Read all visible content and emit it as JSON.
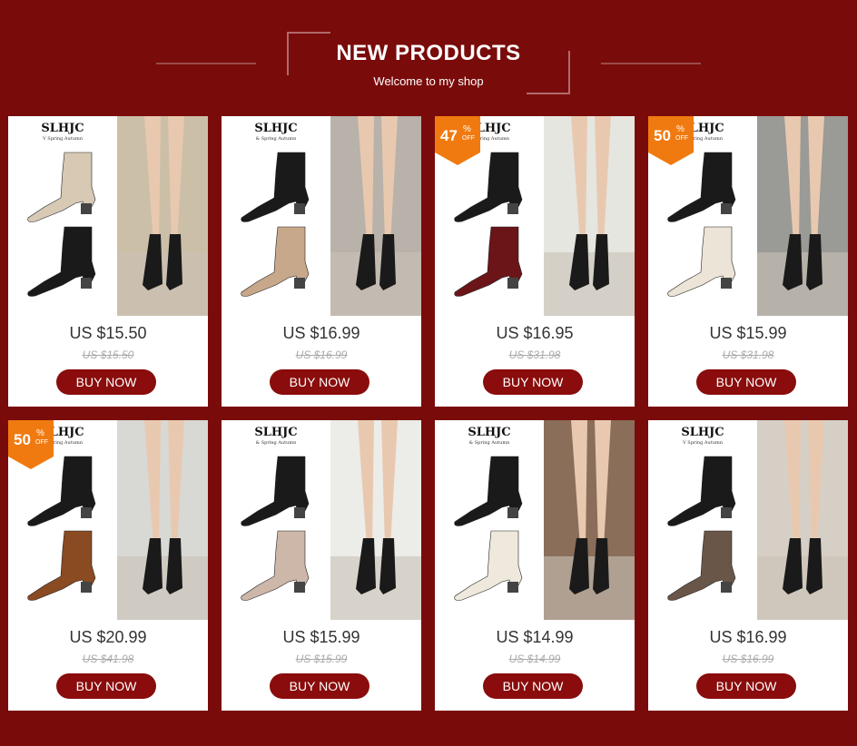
{
  "header": {
    "title": "NEW PRODUCTS",
    "subtitle": "Welcome to my shop"
  },
  "colors": {
    "background": "#7a0b0b",
    "button": "#8a0c0c",
    "badge": "#f07a10"
  },
  "products": [
    {
      "brand": "SLHJC",
      "brand_sub": "V Spring Autumn",
      "price": "US $15.50",
      "old_price": "US $15.50",
      "buy_label": "BUY NOW",
      "badge": null,
      "left_boot_color": "#d8c9b4",
      "left_boot2_color": "#1a1a1a",
      "right_bg": "#ccbfa8"
    },
    {
      "brand": "SLHJC",
      "brand_sub": "& Spring Autumn",
      "price": "US $16.99",
      "old_price": "US $16.99",
      "buy_label": "BUY NOW",
      "badge": null,
      "left_boot_color": "#1a1a1a",
      "left_boot2_color": "#c8a88a",
      "right_bg": "#b8b2aa"
    },
    {
      "brand": "SLHJC",
      "brand_sub": "V Spring Autumn",
      "price": "US $16.95",
      "old_price": "US $31.98",
      "buy_label": "BUY NOW",
      "badge": {
        "num": "47",
        "pct": "%",
        "off": "OFF"
      },
      "left_boot_color": "#1a1a1a",
      "left_boot2_color": "#6b1518",
      "right_bg": "#e6e6e0"
    },
    {
      "brand": "SLHJC",
      "brand_sub": "V Spring Autumn",
      "price": "US $15.99",
      "old_price": "US $31.98",
      "buy_label": "BUY NOW",
      "badge": {
        "num": "50",
        "pct": "%",
        "off": "OFF"
      },
      "left_boot_color": "#1a1a1a",
      "left_boot2_color": "#ece4d6",
      "right_bg": "#9a9a96"
    },
    {
      "brand": "SLHJC",
      "brand_sub": "V Spring Autumn",
      "price": "US $20.99",
      "old_price": "US $41.98",
      "buy_label": "BUY NOW",
      "badge": {
        "num": "50",
        "pct": "%",
        "off": "OFF"
      },
      "left_boot_color": "#1a1a1a",
      "left_boot2_color": "#8a4a22",
      "right_bg": "#d8d8d4"
    },
    {
      "brand": "SLHJC",
      "brand_sub": "& Spring Autumn",
      "price": "US $15.99",
      "old_price": "US $15.99",
      "buy_label": "BUY NOW",
      "badge": null,
      "left_boot_color": "#1a1a1a",
      "left_boot2_color": "#cdb7a8",
      "right_bg": "#ecece8"
    },
    {
      "brand": "SLHJC",
      "brand_sub": "& Spring Autumn",
      "price": "US $14.99",
      "old_price": "US $14.99",
      "buy_label": "BUY NOW",
      "badge": null,
      "left_boot_color": "#1a1a1a",
      "left_boot2_color": "#eee9dc",
      "right_bg": "#8a6e5a"
    },
    {
      "brand": "SLHJC",
      "brand_sub": "V Spring Autumn",
      "price": "US $16.99",
      "old_price": "US $16.99",
      "buy_label": "BUY NOW",
      "badge": null,
      "left_boot_color": "#1a1a1a",
      "left_boot2_color": "#6a5648",
      "right_bg": "#d6cfc6"
    }
  ]
}
